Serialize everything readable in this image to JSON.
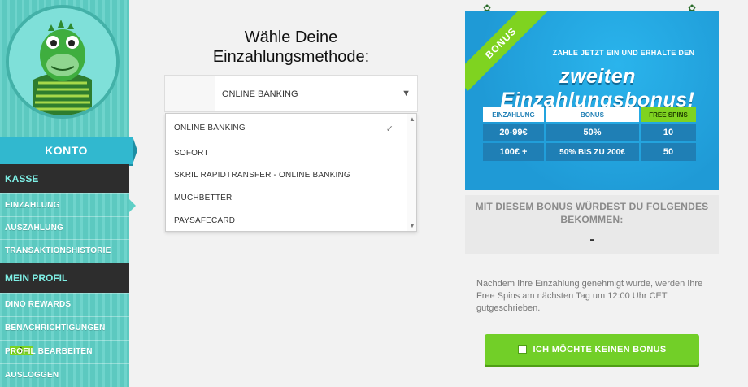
{
  "sidebar": {
    "konto_label": "KONTO",
    "sections": [
      {
        "title": "KASSE",
        "items": [
          "EINZAHLUNG",
          "AUSZAHLUNG",
          "TRANSAKTIONSHISTORIE"
        ]
      },
      {
        "title": "MEIN PROFIL",
        "items": [
          "DINO REWARDS",
          "BENACHRICHTIGUNGEN",
          "PROFIL BEARBEITEN",
          "AUSLOGGEN"
        ]
      }
    ],
    "notification_count": "1",
    "colors": {
      "bg": "#5fcfc6",
      "section": "#2d2d2d",
      "section_text": "#7ff0e6",
      "konto": "#31b8cf"
    }
  },
  "main": {
    "title_line1": "Wähle Deine",
    "title_line2": "Einzahlungsmethode:",
    "select_value": "ONLINE BANKING",
    "options": [
      "ONLINE BANKING",
      "SOFORT",
      "SKRIL RAPIDTRANSFER - ONLINE BANKING",
      "MUCHBETTER",
      "PAYSAFECARD"
    ],
    "selected_option": "ONLINE BANKING"
  },
  "bonus": {
    "ribbon": "BONUS",
    "top_text": "ZAHLE JETZT EIN UND ERHALTE DEN",
    "main_text": "zweiten Einzahlungsbonus!",
    "headers": [
      "EINZAHLUNG",
      "BONUS",
      "FREE SPINS"
    ],
    "rows": [
      [
        "20-99€",
        "50%",
        "10"
      ],
      [
        "100€ +",
        "50% BIS ZU 200€",
        "50"
      ]
    ],
    "colors": {
      "bg": "#1f9ad6",
      "cell": "#1f7fb5",
      "green": "#7fd320"
    }
  },
  "notice": {
    "title": "MIT DIESEM BONUS WÜRDEST DU FOLGENDES BEKOMMEN:",
    "value": "-"
  },
  "info_text": "Nachdem Ihre Einzahlung genehmigt wurde, werden Ihre Free Spins am nächsten Tag um 12:00 Uhr CET gutgeschrieben.",
  "no_bonus_button": "ICH MÖCHTE KEINEN BONUS"
}
